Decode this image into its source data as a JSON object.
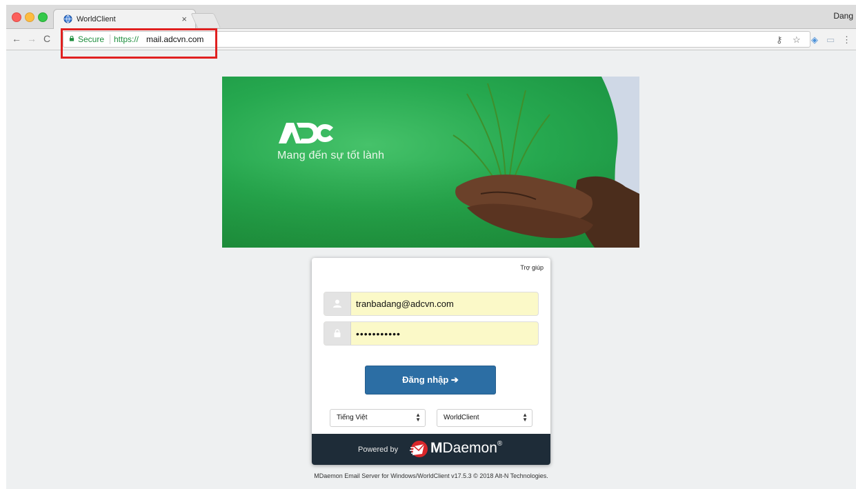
{
  "browser": {
    "tab_title": "WorldClient",
    "tab_close": "×",
    "profile_name": "Dang",
    "secure_label": "Secure",
    "url_scheme": "https://",
    "url_host": "mail.adcvn.com"
  },
  "banner": {
    "logo_text": "ADC",
    "tagline": "Mang đến sự tốt lành"
  },
  "login": {
    "help_link": "Trợ giúp",
    "username_value": "tranbadang@adcvn.com",
    "password_value": "•••••••••••",
    "submit_label": "Đăng nhập ➔",
    "language_select": "Tiếng Việt",
    "client_select": "WorldClient",
    "powered_by": "Powered by",
    "brand_bold": "M",
    "brand_rest": "Daemon",
    "brand_reg": "®"
  },
  "footer": {
    "copyright": "MDaemon Email Server for Windows/WorldClient v17.5.3 © 2018 Alt-N Technologies."
  },
  "colors": {
    "secure_green": "#1e8e3e",
    "login_button": "#2c6ea4",
    "footer_bar": "#1e2c38",
    "highlight_red": "#e02020",
    "input_fill": "#fbf9c8"
  },
  "icons": [
    "globe-icon",
    "lock-icon",
    "key-icon",
    "star-icon",
    "user-icon",
    "padlock-icon",
    "mdaemon-logo-icon"
  ]
}
